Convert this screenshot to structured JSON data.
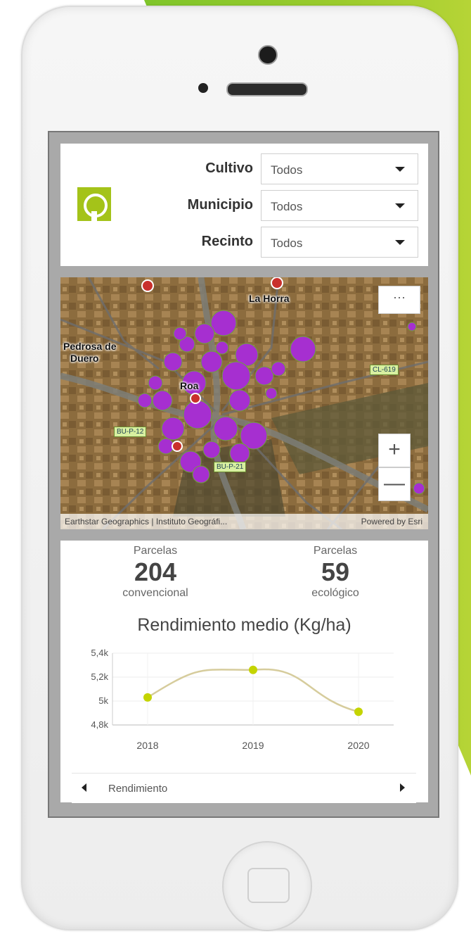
{
  "filters": {
    "cultivo": {
      "label": "Cultivo",
      "value": "Todos"
    },
    "municipio": {
      "label": "Municipio",
      "value": "Todos"
    },
    "recinto": {
      "label": "Recinto",
      "value": "Todos"
    }
  },
  "map": {
    "more_label": "···",
    "zoom_in_label": "+",
    "zoom_out_label": "—",
    "places": {
      "la_horra": "La Horra",
      "pedrosa_1": "Pedrosa de",
      "pedrosa_2": "Duero",
      "roa": "Roa"
    },
    "roads": {
      "cl619": "CL-619",
      "road_a": "BU-P-12",
      "road_b": "BU-P-21"
    },
    "attribution_left": "Earthstar Geographics | Instituto Geográfi...",
    "attribution_right": "Powered by Esri",
    "parcel_color": "#a62fd0"
  },
  "stats": {
    "convencional": {
      "caption": "Parcelas",
      "value": "204",
      "subtitle": "convencional"
    },
    "ecologico": {
      "caption": "Parcelas",
      "value": "59",
      "subtitle": "ecológico"
    }
  },
  "chart_title": "Rendimiento medio (Kg/ha)",
  "chart_data": {
    "type": "line",
    "categories": [
      "2018",
      "2019",
      "2020"
    ],
    "values": [
      5030,
      5260,
      4910
    ],
    "y_ticks": [
      "4,8k",
      "5k",
      "5,2k",
      "5,4k"
    ],
    "ylim": [
      4800,
      5400
    ],
    "grid": true,
    "line_color": "#d6cc9c",
    "point_color": "#c4d400"
  },
  "legend": {
    "label": "Rendimiento"
  },
  "colors": {
    "brand": "#a4c319",
    "accent_stripe": "#8fc82b"
  }
}
